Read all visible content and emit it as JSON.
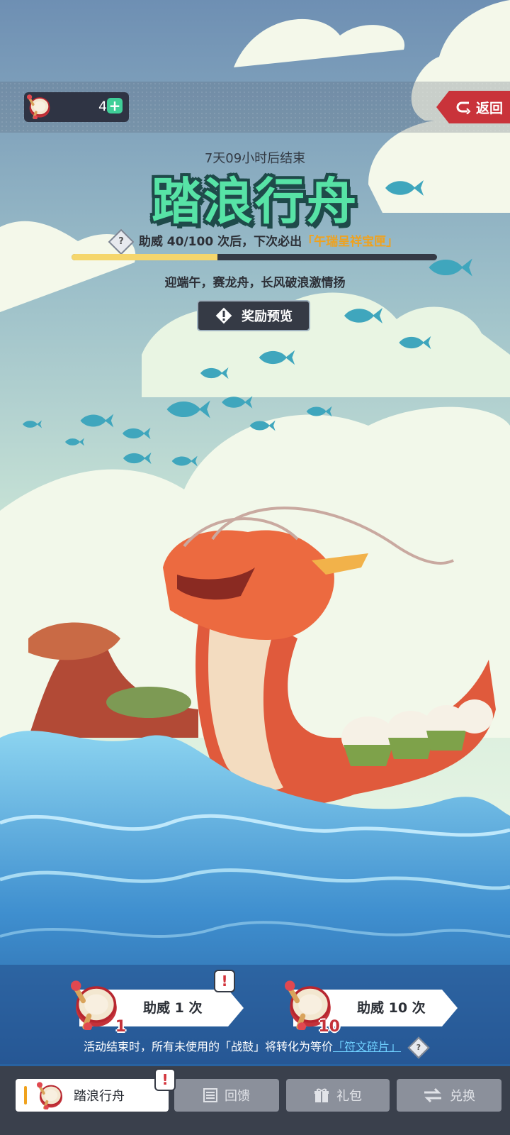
{
  "currency": {
    "icon": "war-drum-icon",
    "count": "4",
    "add_icon": "plus-icon"
  },
  "back": {
    "label": "返回",
    "icon": "return-arrow-icon"
  },
  "event": {
    "countdown": "7天09小时后结束",
    "title": "踏浪行舟",
    "cheer_prefix": "助威 40/100 次后，下次必出",
    "cheer_reward": "「午瑞呈祥宝匣」",
    "progress_fraction": 0.4,
    "slogan": "迎端午，赛龙舟，长风破浪激情扬",
    "preview_label": "奖励预览"
  },
  "cheer_buttons": [
    {
      "label": "助威 1 次",
      "badge": "1"
    },
    {
      "label": "助威 10 次",
      "badge": "10"
    }
  ],
  "alert_mark": "!",
  "help_mark": "?",
  "footnote": {
    "prefix": "活动结束时，所有未使用的「战鼓」将转化为等价",
    "link": "「符文碎片」"
  },
  "tabs": [
    {
      "label": "踏浪行舟",
      "icon": "war-drum-icon",
      "active": true
    },
    {
      "label": "回馈",
      "icon": "ledger-icon",
      "active": false
    },
    {
      "label": "礼包",
      "icon": "gift-icon",
      "active": false
    },
    {
      "label": "兑换",
      "icon": "swap-arrows-icon",
      "active": false
    }
  ],
  "colors": {
    "title_green": "#57e3a6",
    "reward_orange": "#f0a21d",
    "back_red": "#c9333a",
    "tab_bar": "#3a404c"
  }
}
